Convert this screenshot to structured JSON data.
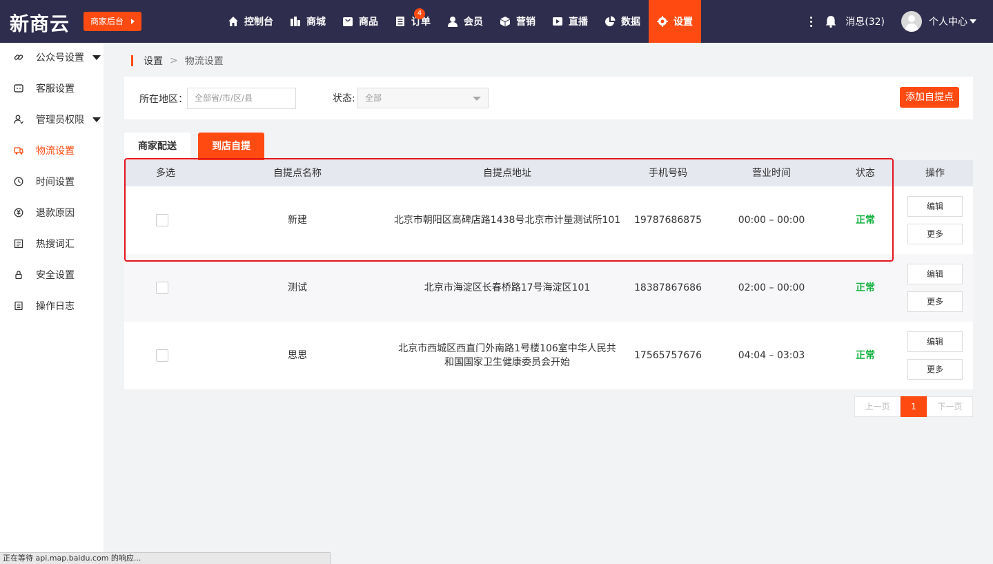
{
  "app": {
    "logo_text": "新商云",
    "merchant_button": "商家后台"
  },
  "nav": {
    "items": [
      {
        "label": "控制台",
        "icon": "home-icon"
      },
      {
        "label": "商城",
        "icon": "mall-icon"
      },
      {
        "label": "商品",
        "icon": "shopping-bag-icon"
      },
      {
        "label": "订单",
        "icon": "order-icon",
        "badge": "4"
      },
      {
        "label": "会员",
        "icon": "member-icon"
      },
      {
        "label": "营销",
        "icon": "cube-icon"
      },
      {
        "label": "直播",
        "icon": "live-icon"
      },
      {
        "label": "数据",
        "icon": "pie-chart-icon"
      },
      {
        "label": "设置",
        "icon": "gear-icon",
        "active": true
      }
    ],
    "messages_label": "消息(32)",
    "profile_label": "个人中心"
  },
  "sidebar": {
    "items": [
      {
        "label": "公众号设置",
        "icon": "link-icon",
        "expandable": true
      },
      {
        "label": "客服设置",
        "icon": "chat-icon"
      },
      {
        "label": "管理员权限",
        "icon": "user-permission-icon",
        "expandable": true
      },
      {
        "label": "物流设置",
        "icon": "truck-icon",
        "active": true
      },
      {
        "label": "时间设置",
        "icon": "clock-icon"
      },
      {
        "label": "退款原因",
        "icon": "refund-icon"
      },
      {
        "label": "热搜词汇",
        "icon": "list-icon"
      },
      {
        "label": "安全设置",
        "icon": "lock-icon"
      },
      {
        "label": "操作日志",
        "icon": "log-icon"
      }
    ]
  },
  "breadcrumb": {
    "current": "设置",
    "separator": ">",
    "sub": "物流设置"
  },
  "filter": {
    "region_label": "所在地区：",
    "region_placeholder": "全部省/市/区/县",
    "status_label": "状态:",
    "status_value": "全部",
    "add_button": "添加自提点"
  },
  "tabs": [
    {
      "label": "商家配送",
      "active": false
    },
    {
      "label": "到店自提",
      "active": true
    }
  ],
  "table": {
    "headers": [
      "多选",
      "自提点名称",
      "自提点地址",
      "手机号码",
      "营业时间",
      "状态",
      "操作"
    ],
    "rows": [
      {
        "name": "新建",
        "address": "北京市朝阳区高碑店路1438号北京市计量测试所101",
        "phone": "19787686875",
        "hours": "00:00 – 00:00",
        "status": "正常",
        "edit": "编辑",
        "more": "更多"
      },
      {
        "name": "测试",
        "address": "北京市海淀区长春桥路17号海淀区101",
        "phone": "18387867686",
        "hours": "02:00 – 00:00",
        "status": "正常",
        "edit": "编辑",
        "more": "更多"
      },
      {
        "name": "思思",
        "address": "北京市西城区西直门外南路1号楼106室中华人民共和国国家卫生健康委员会开始",
        "phone": "17565757676",
        "hours": "04:04 – 03:03",
        "status": "正常",
        "edit": "编辑",
        "more": "更多"
      }
    ]
  },
  "pagination": {
    "prev": "上一页",
    "current": "1",
    "next": "下一页"
  },
  "statusbar": {
    "text": "正在等待 api.map.baidu.com 的响应..."
  },
  "colors": {
    "accent": "#ff4b12",
    "topbar": "#2f2d4d",
    "status_ok": "#13b240",
    "highlight": "#e3141c"
  }
}
